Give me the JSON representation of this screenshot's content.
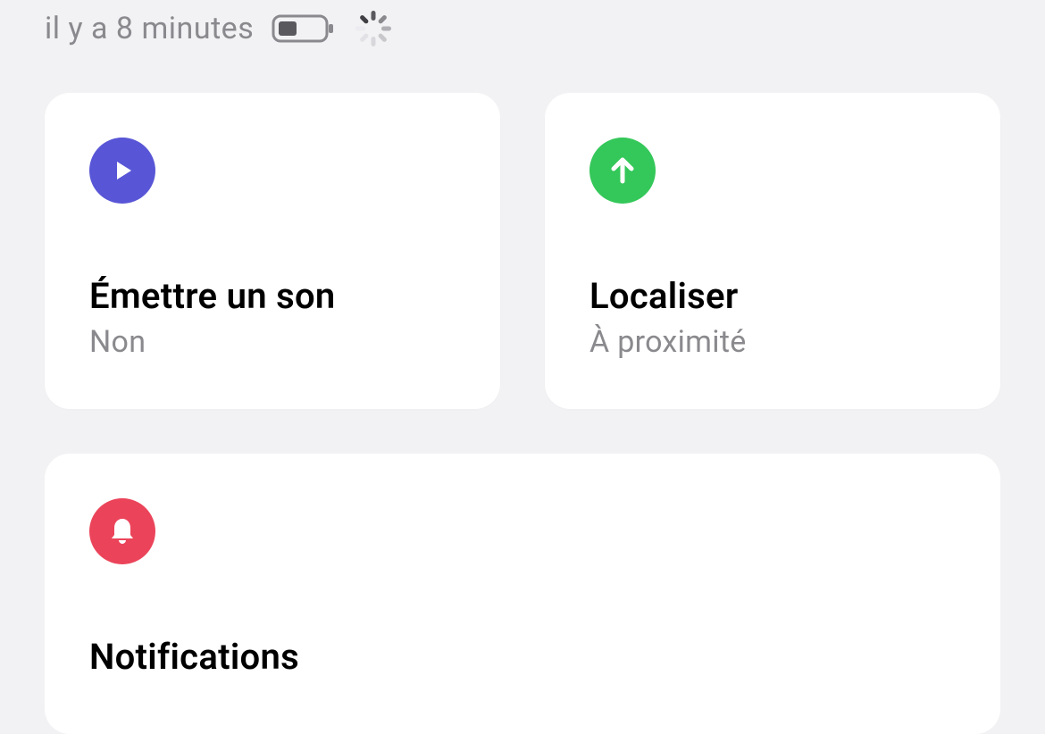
{
  "status": {
    "time_ago": "il y a 8 minutes"
  },
  "cards": {
    "play_sound": {
      "title": "Émettre un son",
      "subtitle": "Non"
    },
    "locate": {
      "title": "Localiser",
      "subtitle": "À proximité"
    },
    "notifications": {
      "title": "Notifications"
    }
  }
}
